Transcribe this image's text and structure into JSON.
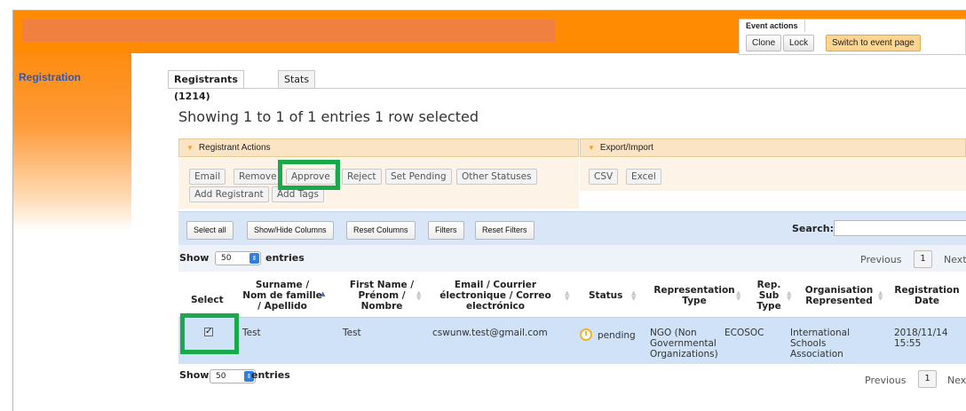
{
  "event_actions": {
    "title": "Event actions",
    "clone": "Clone",
    "lock": "Lock",
    "switch": "Switch to event page"
  },
  "sidebar": {
    "registration": "Registration"
  },
  "tabs": {
    "registrants": "Registrants (1214)",
    "stats": "Stats"
  },
  "showing": "Showing 1 to 1 of 1 entries 1 row selected",
  "registrant_actions": {
    "header": "Registrant Actions",
    "email": "Email",
    "remove": "Remove",
    "approve": "Approve",
    "reject": "Reject",
    "set_pending": "Set Pending",
    "other_statuses": "Other Statuses",
    "add_registrant": "Add Registrant",
    "add_tags": "Add Tags"
  },
  "export_import": {
    "header": "Export/Import",
    "csv": "CSV",
    "excel": "Excel"
  },
  "controls": {
    "select_all": "Select all",
    "show_hide": "Show/Hide Columns",
    "reset_columns": "Reset Columns",
    "filters": "Filters",
    "reset_filters": "Reset Filters",
    "search_label": "Search:",
    "search_value": ""
  },
  "length": {
    "show": "Show",
    "value": "50",
    "entries": "entries"
  },
  "pager": {
    "previous": "Previous",
    "page": "1",
    "next_top": "Next",
    "next_bottom": "Nex"
  },
  "columns": {
    "select": "Select",
    "surname": [
      "Surname /",
      "Nom de famille",
      "/ Apellido"
    ],
    "first_name": [
      "First Name /",
      "Prénom /",
      "Nombre"
    ],
    "email": [
      "Email / Courrier",
      "électronique / Correo",
      "electrónico"
    ],
    "status": "Status",
    "rep_type": [
      "Representation",
      "Type"
    ],
    "rep_sub": [
      "Rep.",
      "Sub",
      "Type"
    ],
    "org": [
      "Organisation",
      "Represented"
    ],
    "reg_date": [
      "Registration",
      "Date"
    ]
  },
  "row": {
    "checked": true,
    "surname": "Test",
    "first_name": "Test",
    "email": "cswunw.test@gmail.com",
    "status": "pending",
    "rep_type": [
      "NGO (Non",
      "Governmental",
      "Organizations)"
    ],
    "rep_sub": "ECOSOC",
    "org": [
      "International",
      "Schools",
      "Association"
    ],
    "reg_date": [
      "2018/11/14",
      "15:55"
    ]
  },
  "colors": {
    "orange": "#fe8b01",
    "highlight": "#17a94a",
    "link": "#2a58c2",
    "row_selected": "#cfe2f8"
  }
}
